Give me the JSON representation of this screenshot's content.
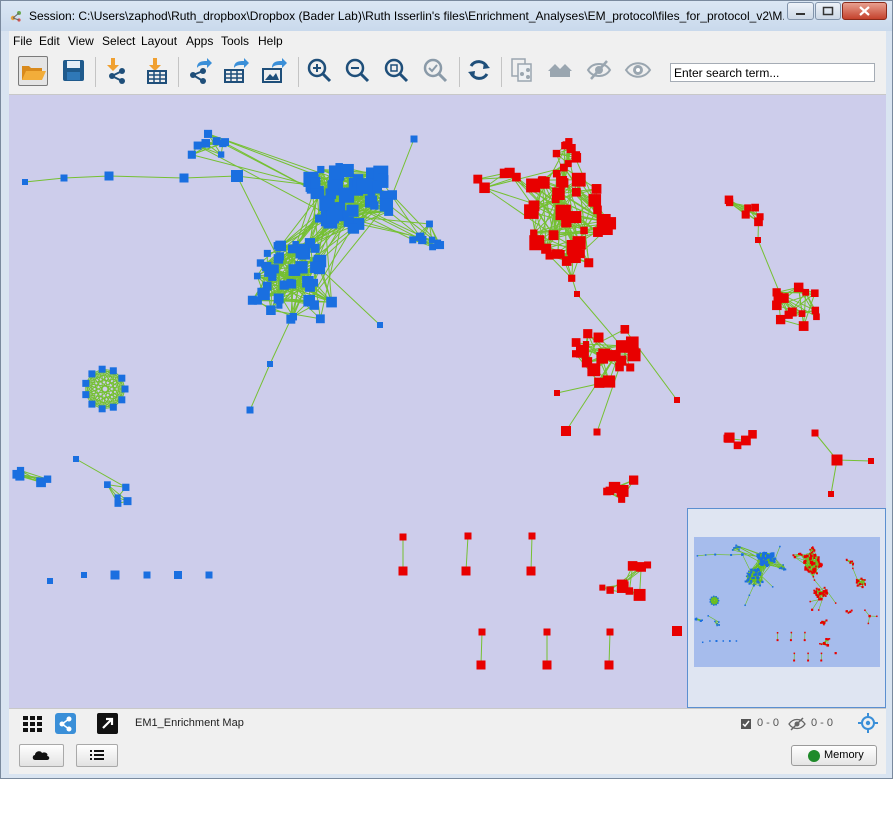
{
  "window": {
    "title": "Session: C:\\Users\\zaphod\\Ruth_dropbox\\Dropbox (Bader Lab)\\Ruth Isserlin's files\\Enrichment_Analyses\\EM_protocol\\files_for_protocol_v2\\M..."
  },
  "menu": {
    "file": "File",
    "edit": "Edit",
    "view": "View",
    "select": "Select",
    "layout": "Layout",
    "apps": "Apps",
    "tools": "Tools",
    "help": "Help"
  },
  "toolbar": {
    "search_placeholder": "Enter search term...",
    "icons": [
      "open-session-icon",
      "save-session-icon",
      "import-network-icon",
      "import-table-icon",
      "export-network-icon",
      "export-table-icon",
      "export-image-icon",
      "zoom-in-icon",
      "zoom-out-icon",
      "zoom-fit-icon",
      "zoom-selected-icon",
      "refresh-icon",
      "new-network-from-selection-icon",
      "home-icon",
      "hide-icon",
      "show-icon"
    ]
  },
  "status": {
    "network_name": "EM1_Enrichment Map",
    "selected_nodes": "0 - 0",
    "selected_edges": "0 - 0"
  },
  "bottom": {
    "memory_label": "Memory"
  },
  "colors": {
    "canvas_background": "#cdcdeb",
    "node_upregulated": "#e80000",
    "node_downregulated": "#1a6fe0",
    "edge": "#6cbf1f",
    "navigator_viewport": "#a6bcec"
  }
}
